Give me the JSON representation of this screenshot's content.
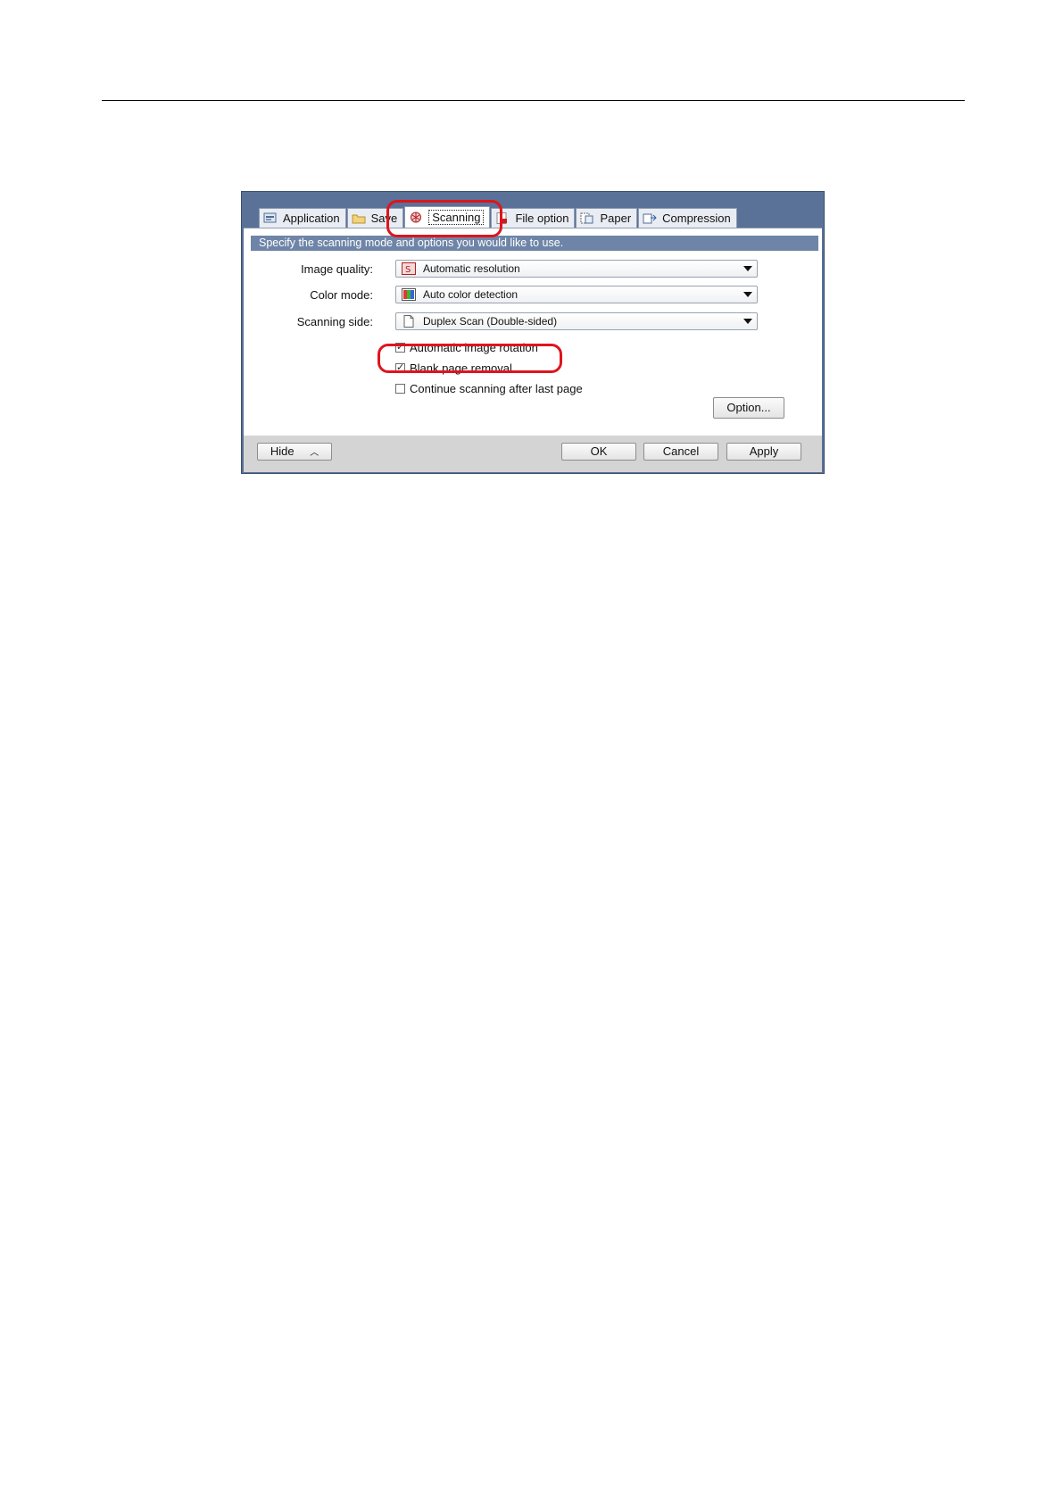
{
  "tabs": [
    {
      "label": "Application",
      "icon": "application-icon",
      "active": false
    },
    {
      "label": "Save",
      "icon": "folder-icon",
      "active": false
    },
    {
      "label": "Scanning",
      "icon": "scanning-icon",
      "active": true
    },
    {
      "label": "File option",
      "icon": "file-option-icon",
      "active": false
    },
    {
      "label": "Paper",
      "icon": "paper-icon",
      "active": false
    },
    {
      "label": "Compression",
      "icon": "compression-icon",
      "active": false
    }
  ],
  "panel": {
    "hint": "Specify the scanning mode and options you would like to use.",
    "image_quality": {
      "label": "Image quality:",
      "value": "Automatic resolution",
      "icon": "resolution-icon"
    },
    "color_mode": {
      "label": "Color mode:",
      "value": "Auto color detection",
      "icon": "color-detection-icon"
    },
    "scanning_side": {
      "label": "Scanning side:",
      "value": "Duplex Scan (Double-sided)",
      "icon": "page-icon"
    },
    "checkboxes": [
      {
        "label": "Automatic image rotation",
        "checked": true
      },
      {
        "label": "Blank page removal",
        "checked": true
      },
      {
        "label": "Continue scanning after last page",
        "checked": false
      }
    ],
    "option_button": "Option..."
  },
  "footer": {
    "hide_button": "Hide",
    "ok_button": "OK",
    "cancel_button": "Cancel",
    "apply_button": "Apply"
  },
  "colors": {
    "window_frame": "#5a7198",
    "hint_bar": "#6f85a8",
    "callout": "#e0141c",
    "footer": "#d4d4d4"
  }
}
